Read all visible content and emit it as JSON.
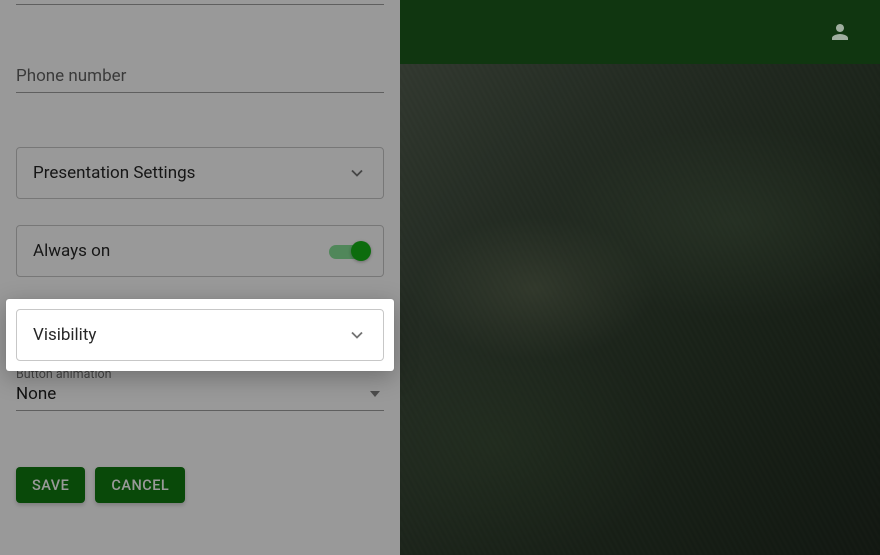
{
  "topbar": {
    "user_icon": "person-icon"
  },
  "sidebar": {
    "phone_label": "Phone number",
    "presentation_label": "Presentation Settings",
    "always_on_label": "Always on",
    "always_on_value": true,
    "visibility_label": "Visibility",
    "select": {
      "caption": "Button animation",
      "value": "None"
    },
    "buttons": {
      "save": "SAVE",
      "cancel": "CANCEL"
    }
  },
  "colors": {
    "brand_green": "#0f7a0f",
    "switch_green": "#15b516"
  }
}
